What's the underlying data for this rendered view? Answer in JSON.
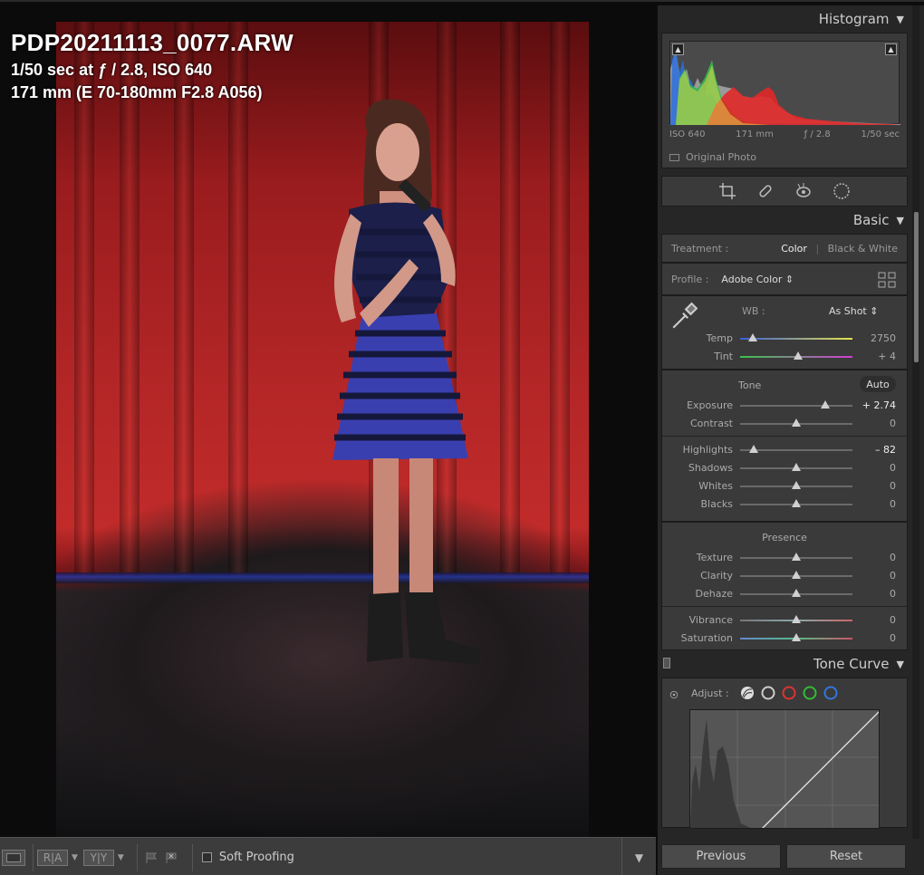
{
  "photo": {
    "filename": "PDP20211113_0077.ARW",
    "exposure_line": "1/50 sec at ƒ / 2.8, ISO 640",
    "lens_line": "171 mm (E 70-180mm F2.8 A056)"
  },
  "toolbar": {
    "view_btn_2": "R|A",
    "view_btn_3": "Y|Y",
    "soft_proofing_label": "Soft Proofing",
    "soft_proofing_checked": false
  },
  "histogram": {
    "title": "Histogram",
    "iso": "ISO 640",
    "focal": "171 mm",
    "aperture": "ƒ / 2.8",
    "shutter": "1/50 sec",
    "original_photo_label": "Original Photo"
  },
  "tools": [
    "crop-icon",
    "heal-icon",
    "redeye-icon",
    "mask-icon"
  ],
  "basic": {
    "title": "Basic",
    "treatment_label": "Treatment :",
    "treatment_color": "Color",
    "treatment_bw": "Black & White",
    "profile_label": "Profile :",
    "profile_value": "Adobe Color",
    "wb_label": "WB :",
    "wb_value": "As Shot",
    "temp": {
      "label": "Temp",
      "value": "2750",
      "pos": 0.11
    },
    "tint": {
      "label": "Tint",
      "value": "+ 4",
      "pos": 0.52
    },
    "tone_label": "Tone",
    "auto_label": "Auto",
    "exposure": {
      "label": "Exposure",
      "value": "+ 2.74",
      "pos": 0.76
    },
    "contrast": {
      "label": "Contrast",
      "value": "0",
      "pos": 0.5
    },
    "highlights": {
      "label": "Highlights",
      "value": "– 82",
      "pos": 0.12
    },
    "shadows": {
      "label": "Shadows",
      "value": "0",
      "pos": 0.5
    },
    "whites": {
      "label": "Whites",
      "value": "0",
      "pos": 0.5
    },
    "blacks": {
      "label": "Blacks",
      "value": "0",
      "pos": 0.5
    },
    "presence_label": "Presence",
    "texture": {
      "label": "Texture",
      "value": "0",
      "pos": 0.5
    },
    "clarity": {
      "label": "Clarity",
      "value": "0",
      "pos": 0.5
    },
    "dehaze": {
      "label": "Dehaze",
      "value": "0",
      "pos": 0.5
    },
    "vibrance": {
      "label": "Vibrance",
      "value": "0",
      "pos": 0.5
    },
    "saturation": {
      "label": "Saturation",
      "value": "0",
      "pos": 0.5
    }
  },
  "tone_curve": {
    "title": "Tone Curve",
    "adjust_label": "Adjust :"
  },
  "buttons": {
    "previous": "Previous",
    "reset": "Reset"
  }
}
